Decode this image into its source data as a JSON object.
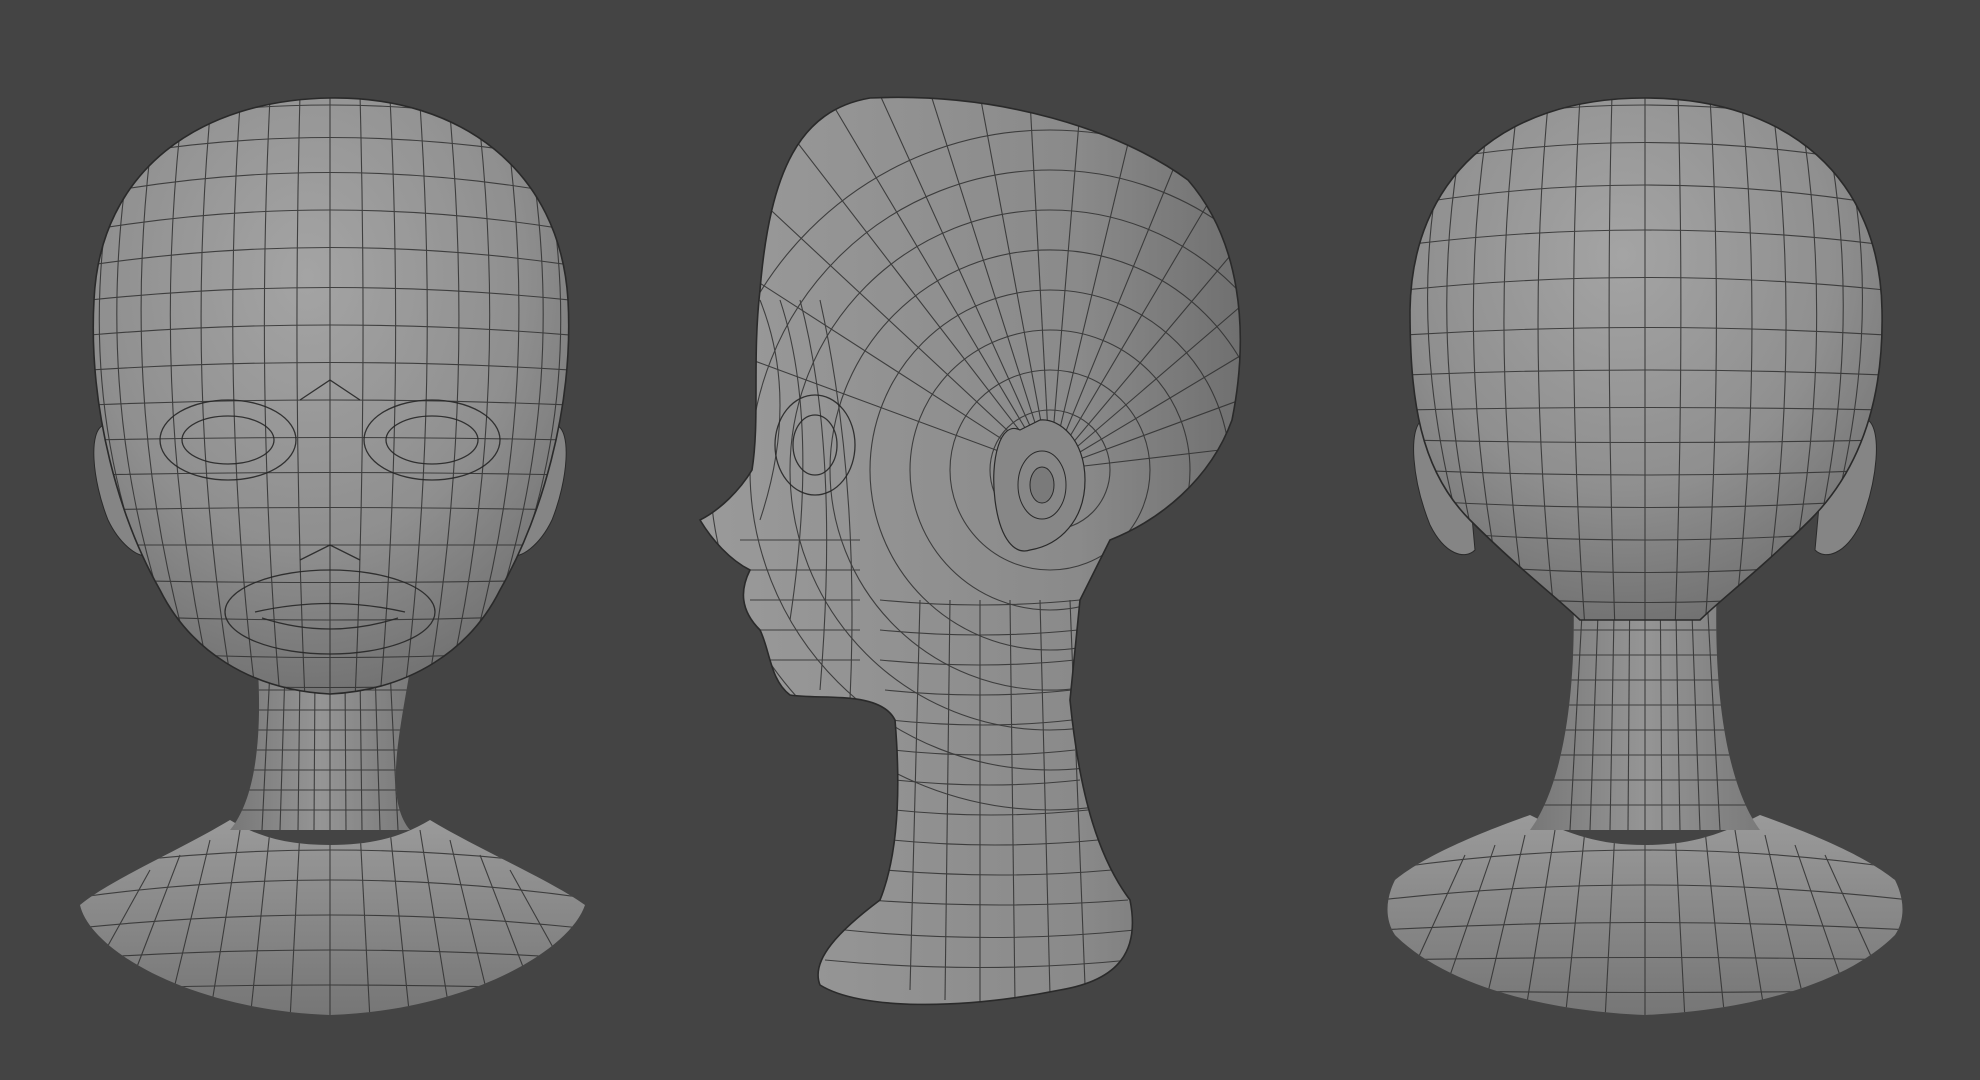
{
  "scene": {
    "background_color": "#444444",
    "mesh_color": "#8c8c8c",
    "mesh_highlight_color": "#a2a2a2",
    "mesh_shadow_color": "#6a6a6a",
    "wire_color": "#2f2f2f"
  },
  "views": [
    {
      "id": "front",
      "icon": "head-front-view"
    },
    {
      "id": "side",
      "icon": "head-side-view"
    },
    {
      "id": "back",
      "icon": "head-back-view"
    }
  ]
}
